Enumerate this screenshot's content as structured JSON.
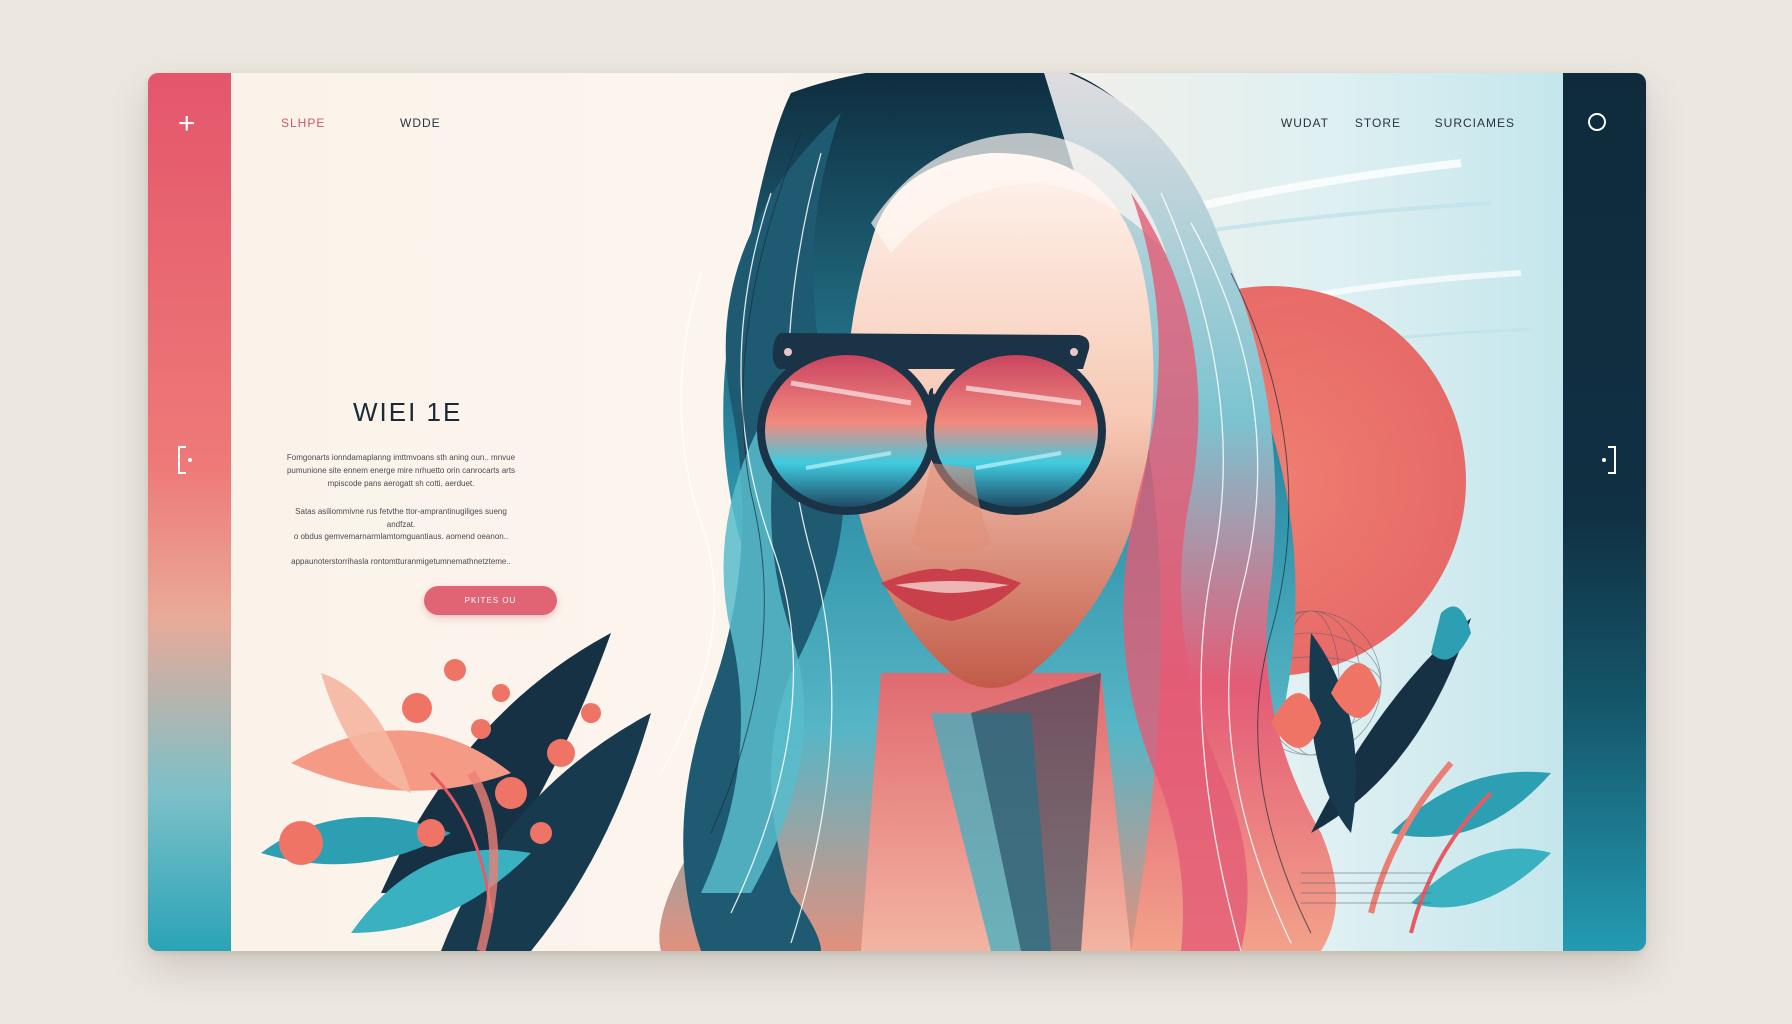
{
  "nav": {
    "left": [
      "SLHPE",
      "WDDE"
    ],
    "right": [
      "WUDAT",
      "STORE",
      "SURCIAMES"
    ]
  },
  "hero": {
    "headline": "WIEI 1E",
    "paragraphs": [
      "Fomgonarts ionndamaplanng imttmvoans sth aning oun.. mnvue pumunione site ennem energe mire nrhuetto orin canrocarts arts mpiscode pans aerogatt sh cotti, aerduet.",
      "Satas asiliommivne rus fetvthe ttor-amprantinugiliges sueng andfzat.",
      "o obdus gemvemarnarmlamtomguantiaus. aomend oeanon..",
      "appaunoterstorrihasla rontomtturanmigetumnemathnetzteme.."
    ],
    "cta_label": "PKITES OU"
  },
  "icons": {
    "left_top": "+",
    "left_mid": "bracket-left-icon",
    "right_top": "circle-icon",
    "right_mid": "bracket-right-icon"
  },
  "colors": {
    "accent": "#e06473",
    "dark": "#0f2b3b",
    "teal": "#2aa3b7"
  }
}
